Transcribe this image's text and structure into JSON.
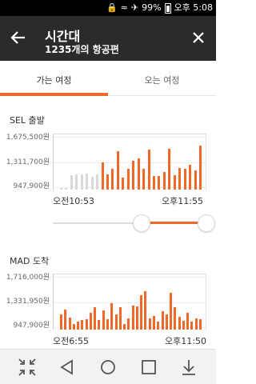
{
  "status_bar": {
    "battery_text": "99%",
    "time_text": "오후 5:08",
    "icons": [
      "lock-icon",
      "wifi-icon",
      "airplane-icon",
      "battery-icon"
    ]
  },
  "app_bar": {
    "title": "시간대",
    "subtitle": "1235개의 항공편",
    "icons": [
      "back-arrow-icon",
      "close-icon"
    ]
  },
  "tabs": [
    {
      "label": "가는 여정",
      "selected": true
    },
    {
      "label": "오는 여정",
      "selected": false
    }
  ],
  "colors": {
    "accent": "#f1692a",
    "bar_inactive": "#d9d9d9",
    "app_bar": "#2b2b2b"
  },
  "outbound": {
    "label": "SEL 출발",
    "y_ticks": [
      "1,675,500원",
      "1,311,700원",
      "947,900원"
    ],
    "start_time": "오전10:53",
    "end_time": "오후11:55",
    "slider": {
      "start_fraction": 0.58,
      "end_fraction": 1.0
    }
  },
  "return": {
    "label": "MAD 도착",
    "y_ticks": [
      "1,716,000원",
      "1,331,950원",
      "947,900원"
    ],
    "start_time": "오전6:55",
    "end_time": "오후11:50"
  },
  "chart_data": [
    {
      "type": "bar",
      "title": "SEL 출발",
      "ylim": [
        947900,
        1675500
      ],
      "y_ticks": [
        1675500,
        1311700,
        947900
      ],
      "series": [
        {
          "values": [
            947900,
            947900,
            1130000,
            1150000,
            1140000,
            1160000,
            1110000,
            1140000,
            1320000,
            1150000,
            1230000,
            1480000,
            1100000,
            1230000,
            1340000,
            1370000,
            1230000,
            1500000,
            1120000,
            1120000,
            1180000,
            1510000,
            1130000,
            1240000,
            1220000,
            1280000,
            1200000,
            1560000
          ]
        }
      ],
      "active_mask": [
        false,
        false,
        false,
        false,
        false,
        false,
        false,
        false,
        true,
        true,
        true,
        true,
        true,
        true,
        true,
        true,
        true,
        true,
        true,
        true,
        true,
        true,
        true,
        true,
        true,
        true,
        true,
        true
      ]
    },
    {
      "type": "bar",
      "title": "MAD 도착",
      "ylim": [
        947900,
        1716000
      ],
      "y_ticks": [
        1716000,
        1331950,
        947900
      ],
      "series": [
        {
          "values": [
            1160000,
            1230000,
            1110000,
            1010000,
            1050000,
            1070000,
            1080000,
            1180000,
            1260000,
            1070000,
            1220000,
            1080000,
            1320000,
            1160000,
            1260000,
            1010000,
            1090000,
            1290000,
            1280000,
            1450000,
            1510000,
            1100000,
            1130000,
            1050000,
            1200000,
            1150000,
            1490000,
            1260000,
            1120000,
            1060000,
            1180000,
            1050000,
            1100000,
            1080000
          ]
        }
      ]
    }
  ]
}
